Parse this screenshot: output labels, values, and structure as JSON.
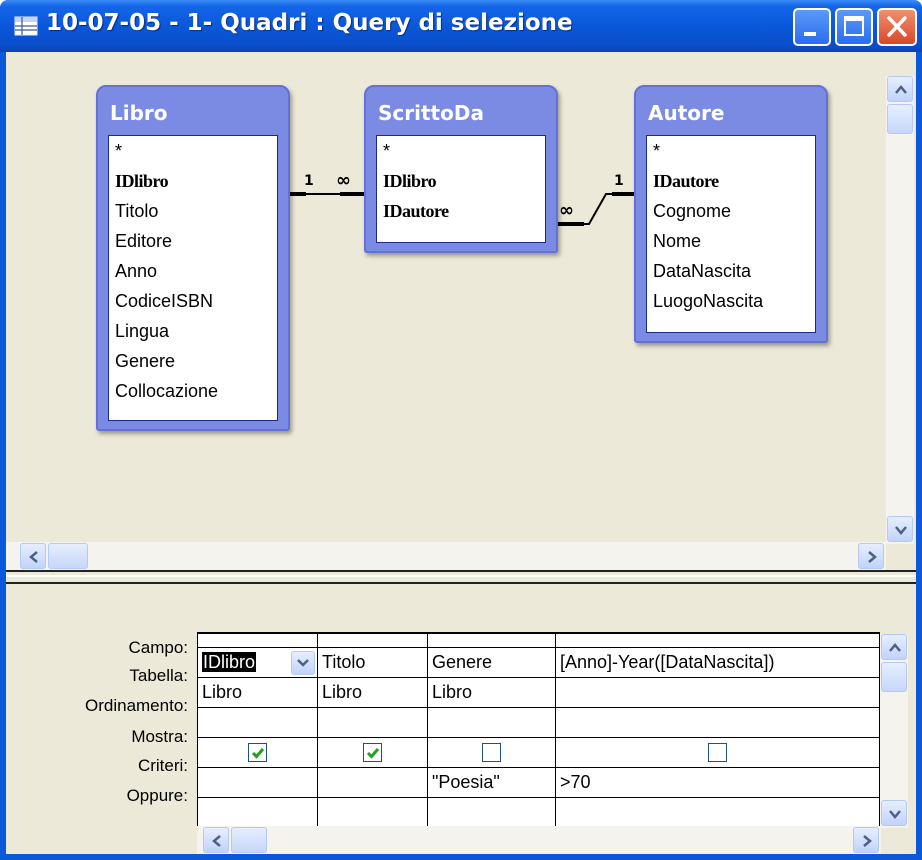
{
  "window": {
    "title": "10-07-05 - 1- Quadri : Query di selezione"
  },
  "tables": [
    {
      "name": "Libro",
      "fields": [
        {
          "label": "*",
          "key": false
        },
        {
          "label": "IDlibro",
          "key": true
        },
        {
          "label": "Titolo",
          "key": false
        },
        {
          "label": "Editore",
          "key": false
        },
        {
          "label": "Anno",
          "key": false
        },
        {
          "label": "CodiceISBN",
          "key": false
        },
        {
          "label": "Lingua",
          "key": false
        },
        {
          "label": "Genere",
          "key": false
        },
        {
          "label": "Collocazione",
          "key": false
        }
      ]
    },
    {
      "name": "ScrittoDa",
      "fields": [
        {
          "label": "*",
          "key": false
        },
        {
          "label": "IDlibro",
          "key": true
        },
        {
          "label": "IDautore",
          "key": true
        }
      ]
    },
    {
      "name": "Autore",
      "fields": [
        {
          "label": "*",
          "key": false
        },
        {
          "label": "IDautore",
          "key": true
        },
        {
          "label": "Cognome",
          "key": false
        },
        {
          "label": "Nome",
          "key": false
        },
        {
          "label": "DataNascita",
          "key": false
        },
        {
          "label": "LuogoNascita",
          "key": false
        }
      ]
    }
  ],
  "relationships": [
    {
      "from": "Libro",
      "to": "ScrittoDa",
      "one": "1",
      "many": "∞"
    },
    {
      "from": "Autore",
      "to": "ScrittoDa",
      "one": "1",
      "many": "∞"
    }
  ],
  "grid": {
    "row_labels": [
      "Campo:",
      "Tabella:",
      "Ordinamento:",
      "Mostra:",
      "Criteri:",
      "Oppure:"
    ],
    "columns": [
      {
        "campo": "IDlibro",
        "tabella": "Libro",
        "ordinamento": "",
        "mostra": true,
        "criteri": "",
        "oppure": ""
      },
      {
        "campo": "Titolo",
        "tabella": "Libro",
        "ordinamento": "",
        "mostra": true,
        "criteri": "",
        "oppure": ""
      },
      {
        "campo": "Genere",
        "tabella": "Libro",
        "ordinamento": "",
        "mostra": false,
        "criteri": "\"Poesia\"",
        "oppure": ""
      },
      {
        "campo": "[Anno]-Year([DataNascita])",
        "tabella": "",
        "ordinamento": "",
        "mostra": false,
        "criteri": ">70",
        "oppure": ""
      }
    ]
  },
  "icons": [
    "query-icon",
    "minimize-icon",
    "maximize-icon",
    "close-icon",
    "scroll-up-icon",
    "scroll-down-icon",
    "scroll-left-icon",
    "scroll-right-icon",
    "dropdown-arrow-icon",
    "checkmark-icon"
  ],
  "colors": {
    "titlebar": "#0a58da",
    "table_header": "#7b8be4",
    "close_button": "#d8482a",
    "workspace": "#ece9d8",
    "check": "#21a121"
  }
}
